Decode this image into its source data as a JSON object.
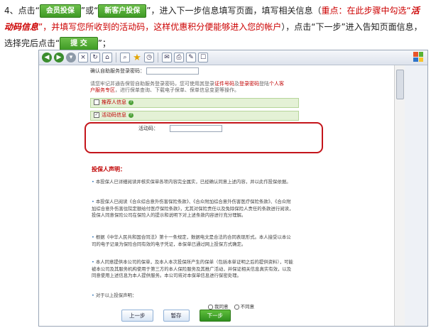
{
  "intro": {
    "t1": "4、点击“",
    "btn_member": "会员投保",
    "t2": "”或“",
    "btn_new": "新客户投保",
    "t3": "”，进入下一步信息填写页面，填写相关信息（",
    "red1": "重点：在此步骤中勾选“",
    "italic1": "活动码信息",
    "red2": "”，并填写您所收到的活动码，这样优惠积分便能够进入您的帐户",
    "t4": "），点击“下一步”进入告知页面信息，选择完后点击“",
    "btn_submit": "提 交",
    "t5": "”；"
  },
  "browser": {
    "back_icon": "back-arrow-icon",
    "forward_icon": "forward-arrow-icon",
    "win_colors": [
      "#e8542b",
      "#59b233",
      "#2f74c8",
      "#f7c32b"
    ]
  },
  "form": {
    "confirm_pwd_label": "确认自助服务登录密码：",
    "note_line1_a": "请您牢记并通告保管自助服务登录密码，您可使用其登录",
    "note_line1_red": "证件号码",
    "note_line1_b": "及",
    "note_line1_red2": "登录密码",
    "note_line1_c": "登陆",
    "note_line1_red3": "个人客",
    "note_line2_red": "户服务专区",
    "note_line2_b": "，进行保单查询、下载电子保单、保单信息变更等操作。",
    "referrer_label": "推荐人信息",
    "activity_label": "活动码信息",
    "activity_check": "✓",
    "activity_code_label": "活动码：",
    "declaration_title": "投保人声明：",
    "decl": [
      "本投保人已详细阅读并核实保单各项内容完全属实，已经确认同意上述内容，并以此作投保依据。",
      "本投保人已阅读《合众综合意外伤害保险条款》、《合众附加综合意外伤害医疗保险条款》、《合众附加综合意外伤害住院定额给付医疗保险条款》，尤其对保险责任以及免除保险人责任的条款进行阅读，投保人同意保险公司在保险人的提示和说明下对上述条款内容进行充分理解。",
      "根据《中华人民共和国合同法》第十一条规定，数据电文是合法的合同表现形式。本人接受以本公司的电子记录为保险合同有效的电子凭证，本保单已通过网上投保方式确定。",
      "本人同意提供本公司的保单，及本人本次投保所产生的保单（包括本单证明之后的提供资料），可能被本公司及其服务机构使用于第三方的本人保险服务及其推广活动，并保证相关信息真实有效，以及同意使用上述信息为本人提供服务。本公司将对本保单信息进行保密处理。",
      "对于以上投保声明："
    ],
    "agree": "我同意",
    "disagree": "不同意",
    "btn_prev": "上一步",
    "btn_save": "暂存",
    "btn_next": "下一步"
  }
}
